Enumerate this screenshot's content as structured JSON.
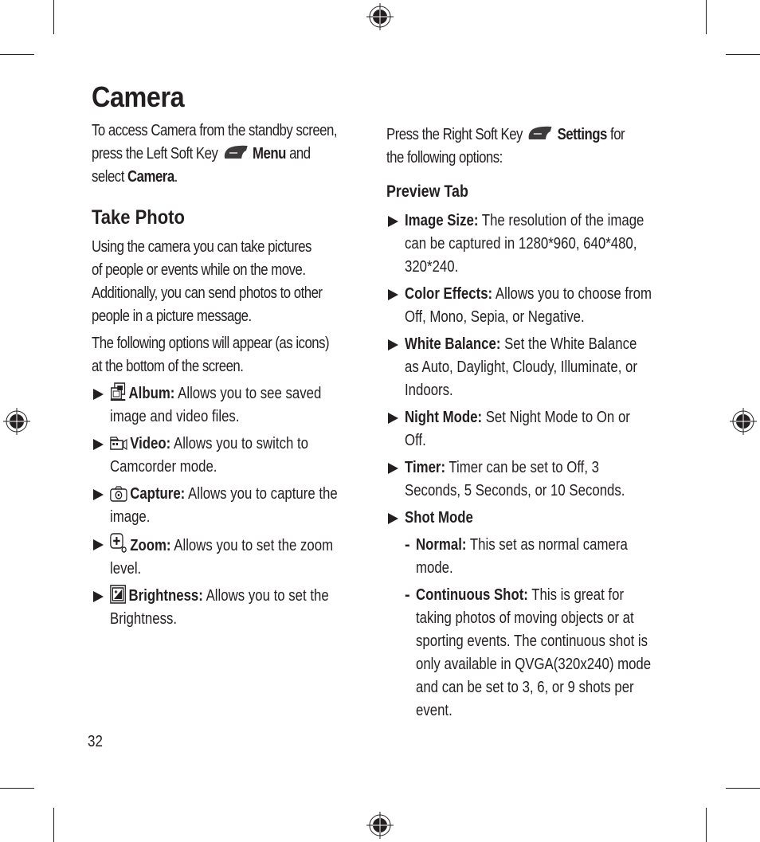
{
  "page": {
    "number": "32",
    "title": "Camera"
  },
  "left": {
    "intro": {
      "line1": "To access Camera from the standby screen,",
      "line2_pre": "press the Left Soft Key",
      "line2_bold": "Menu",
      "line2_post": "and",
      "line3_pre": "select",
      "line3_bold": "Camera",
      "line3_post": "."
    },
    "section_title": "Take Photo",
    "para1": [
      "Using the camera you can take pictures",
      "of people or events while on the move.",
      "Additionally, you can send photos to other",
      "people in a picture message."
    ],
    "para2": [
      "The following options will appear (as icons)",
      "at the bottom of the screen."
    ],
    "options": [
      {
        "icon": "album-icon",
        "label": "Album:",
        "line1": "Allows you to see saved",
        "line2": "image and video files."
      },
      {
        "icon": "video-icon",
        "label": "Video:",
        "line1": "Allows you to switch to",
        "line2": "Camcorder mode."
      },
      {
        "icon": "capture-icon",
        "label": "Capture:",
        "line1": "Allows you to capture the",
        "line2": "image."
      },
      {
        "icon": "zoom-icon",
        "label": "Zoom:",
        "line1": "Allows you to set the zoom",
        "line2": "level."
      },
      {
        "icon": "brightness-icon",
        "label": "Brightness:",
        "line1": "Allows you to set the",
        "line2": "Brightness."
      }
    ]
  },
  "right": {
    "intro": {
      "line1_pre": "Press the Right Soft Key",
      "line1_bold": "Settings",
      "line1_post": "for",
      "line2": "the following options:"
    },
    "tab_title": "Preview Tab",
    "settings": [
      {
        "label": "Image Size:",
        "lines": [
          "The resolution of the image",
          "can be captured in 1280*960, 640*480,",
          "320*240."
        ]
      },
      {
        "label": "Color Effects:",
        "lines": [
          "Allows you to choose from",
          "Off, Mono, Sepia, or Negative."
        ]
      },
      {
        "label": "White Balance:",
        "lines": [
          "Set the White Balance",
          "as Auto, Daylight, Cloudy, Illuminate, or",
          "Indoors."
        ]
      },
      {
        "label": "Night Mode:",
        "lines": [
          "Set Night Mode to On or",
          "Off."
        ]
      },
      {
        "label": "Timer:",
        "lines": [
          "Timer can be set to Off, 3",
          "Seconds, 5 Seconds, or 10 Seconds."
        ]
      }
    ],
    "shot_mode": {
      "label": "Shot Mode",
      "modes": [
        {
          "label": "Normal:",
          "lines": [
            "This set as normal camera",
            "mode."
          ]
        },
        {
          "label": "Continuous Shot:",
          "lines": [
            "This is great for",
            "taking photos of moving objects or at",
            "sporting events. The continuous shot is",
            "only available in QVGA(320x240) mode",
            "and can be set to 3, 6, or 9 shots per",
            "event."
          ]
        }
      ]
    }
  }
}
